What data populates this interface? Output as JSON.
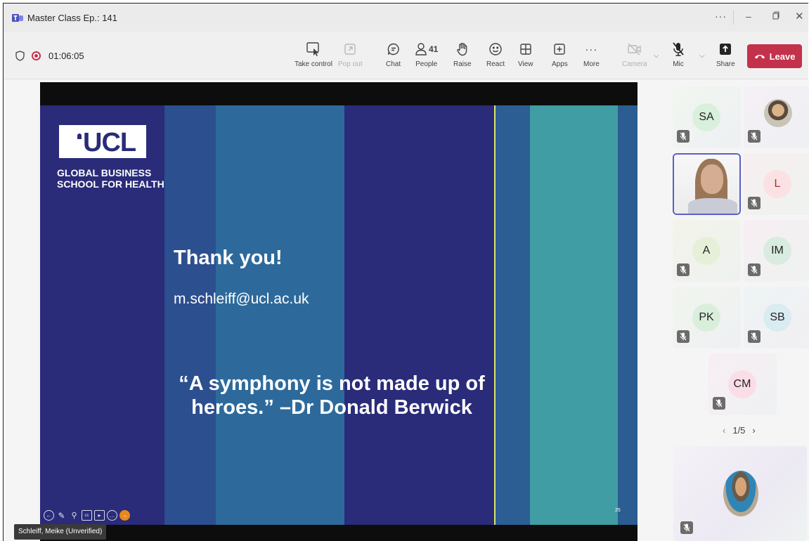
{
  "window": {
    "title": "Master Class Ep.: 141",
    "more_icon": "ellipsis-icon",
    "minimize_icon": "minimize-icon",
    "maximize_icon": "restore-icon",
    "close_icon": "close-icon"
  },
  "meeting": {
    "elapsed": "01:06:05",
    "recording": true
  },
  "toolbar": {
    "take_control": "Take control",
    "pop_out": "Pop out",
    "chat": "Chat",
    "people": "People",
    "people_count": "41",
    "raise": "Raise",
    "react": "React",
    "view": "View",
    "apps": "Apps",
    "more": "More",
    "camera": "Camera",
    "mic": "Mic",
    "share": "Share",
    "leave": "Leave"
  },
  "slide": {
    "logo_text": "UCL",
    "logo_sub_1": "GLOBAL BUSINESS",
    "logo_sub_2": "SCHOOL FOR HEALTH",
    "title": "Thank you!",
    "email": "m.schleiff@ucl.ac.uk",
    "quote_line_1": "“A symphony is not made up of",
    "quote_line_2": "heroes.” –Dr Donald Berwick",
    "page_number": "25"
  },
  "presenter": {
    "name": "Schleiff, Meike (Unverified)"
  },
  "gallery": {
    "tiles": [
      {
        "initials": "SA",
        "color": "#d9f0dc",
        "muted": true
      },
      {
        "initials": "",
        "color": "#f2eef4",
        "muted": true,
        "avatar": "photo"
      },
      {
        "initials": "",
        "color": "#ffffff",
        "muted": false,
        "video": true,
        "active": true
      },
      {
        "initials": "L",
        "color": "#fbe0e4",
        "muted": true
      },
      {
        "initials": "A",
        "color": "#e6f0d8",
        "muted": true
      },
      {
        "initials": "IM",
        "color": "#d8ecdf",
        "muted": true
      },
      {
        "initials": "PK",
        "color": "#d9efdc",
        "muted": true
      },
      {
        "initials": "SB",
        "color": "#d8ecf1",
        "muted": true
      },
      {
        "initials": "CM",
        "color": "#fbdde8",
        "muted": true
      }
    ],
    "page": "1/5"
  },
  "colors": {
    "leave": "#c4314b",
    "slide_navy": "#2a2b79",
    "active_border": "#5b5fc7"
  }
}
